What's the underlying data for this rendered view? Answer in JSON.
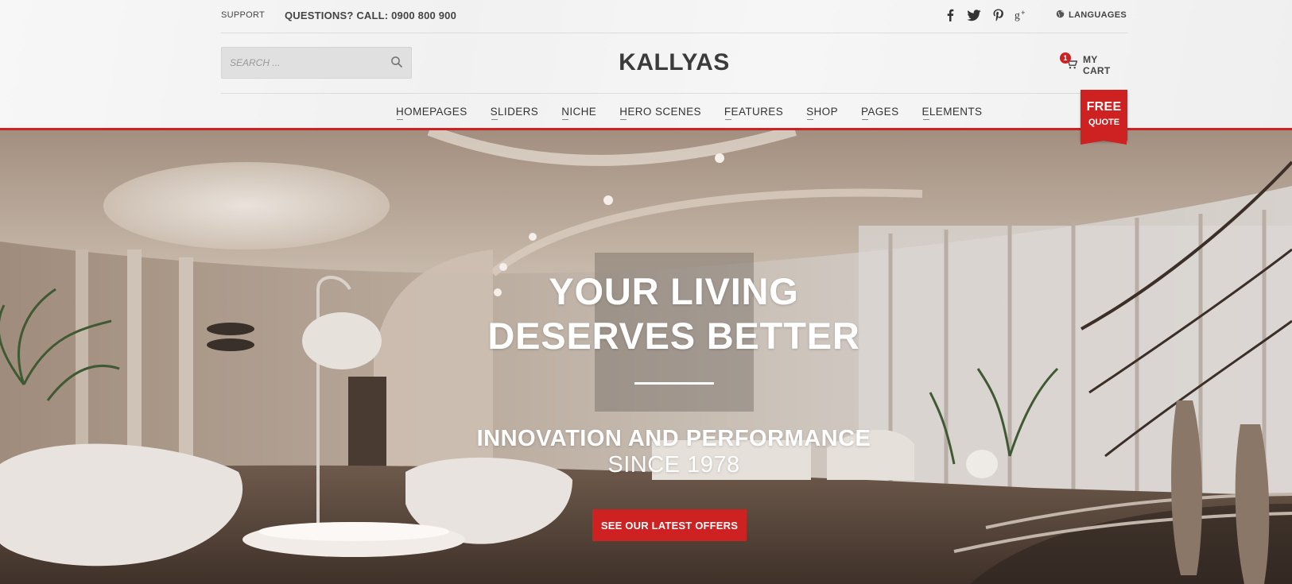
{
  "topbar": {
    "support_label": "SUPPORT",
    "phone_label": "QUESTIONS? CALL: 0900 800 900",
    "social_icons": [
      "facebook-icon",
      "twitter-icon",
      "pinterest-icon",
      "google-plus-icon"
    ],
    "languages_label": "LANGUAGES"
  },
  "search": {
    "placeholder": "SEARCH ..."
  },
  "logo": {
    "text": "KALLYAS"
  },
  "cart": {
    "label": "MY CART",
    "count": "1"
  },
  "nav": {
    "items": [
      "HOMEPAGES",
      "SLIDERS",
      "NICHE",
      "HERO SCENES",
      "FEATURES",
      "SHOP",
      "PAGES",
      "ELEMENTS"
    ]
  },
  "quote": {
    "line1": "FREE",
    "line2": "QUOTE"
  },
  "hero": {
    "title_line1": "YOUR LIVING",
    "title_line2": "DESERVES BETTER",
    "subtitle_line1": "INNOVATION AND PERFORMANCE",
    "subtitle_line2": "SINCE 1978",
    "cta_label": "SEE OUR LATEST OFFERS"
  },
  "colors": {
    "accent": "#cd2122",
    "header_bg": "#f4f4f4",
    "text_dark": "#333333"
  }
}
